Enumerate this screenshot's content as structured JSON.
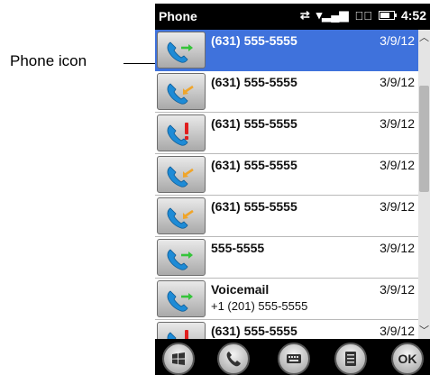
{
  "callout": {
    "label": "Phone icon"
  },
  "status_bar": {
    "title": "Phone",
    "time": "4:52"
  },
  "call_list": [
    {
      "name": "(631) 555-5555",
      "date": "3/9/12",
      "sub": "",
      "call_type": "outgoing",
      "arrow_color": "#35c43a",
      "selected": true
    },
    {
      "name": "(631) 555-5555",
      "date": "3/9/12",
      "sub": "",
      "call_type": "incoming",
      "arrow_color": "#f0a52a",
      "selected": false
    },
    {
      "name": "(631) 555-5555",
      "date": "3/9/12",
      "sub": "",
      "call_type": "missed",
      "arrow_color": "#e01e1e",
      "selected": false
    },
    {
      "name": "(631) 555-5555",
      "date": "3/9/12",
      "sub": "",
      "call_type": "incoming",
      "arrow_color": "#f0a52a",
      "selected": false
    },
    {
      "name": "(631) 555-5555",
      "date": "3/9/12",
      "sub": "",
      "call_type": "incoming",
      "arrow_color": "#f0a52a",
      "selected": false
    },
    {
      "name": "555-5555",
      "date": "3/9/12",
      "sub": "",
      "call_type": "outgoing",
      "arrow_color": "#35c43a",
      "selected": false
    },
    {
      "name": "Voicemail",
      "date": "3/9/12",
      "sub": "+1 (201) 555-5555",
      "call_type": "outgoing",
      "arrow_color": "#35c43a",
      "selected": false
    },
    {
      "name": "(631) 555-5555",
      "date": "3/9/12",
      "sub": "",
      "call_type": "missed",
      "arrow_color": "#e01e1e",
      "selected": false
    }
  ],
  "softkeys": {
    "start_icon": "windows-start-icon",
    "phone_icon": "phone-icon",
    "keyboard_icon": "keyboard-icon",
    "menu_icon": "menu-icon",
    "ok_label": "OK"
  },
  "colors": {
    "selection": "#3f72dc",
    "handset": "#1e8bd6"
  }
}
